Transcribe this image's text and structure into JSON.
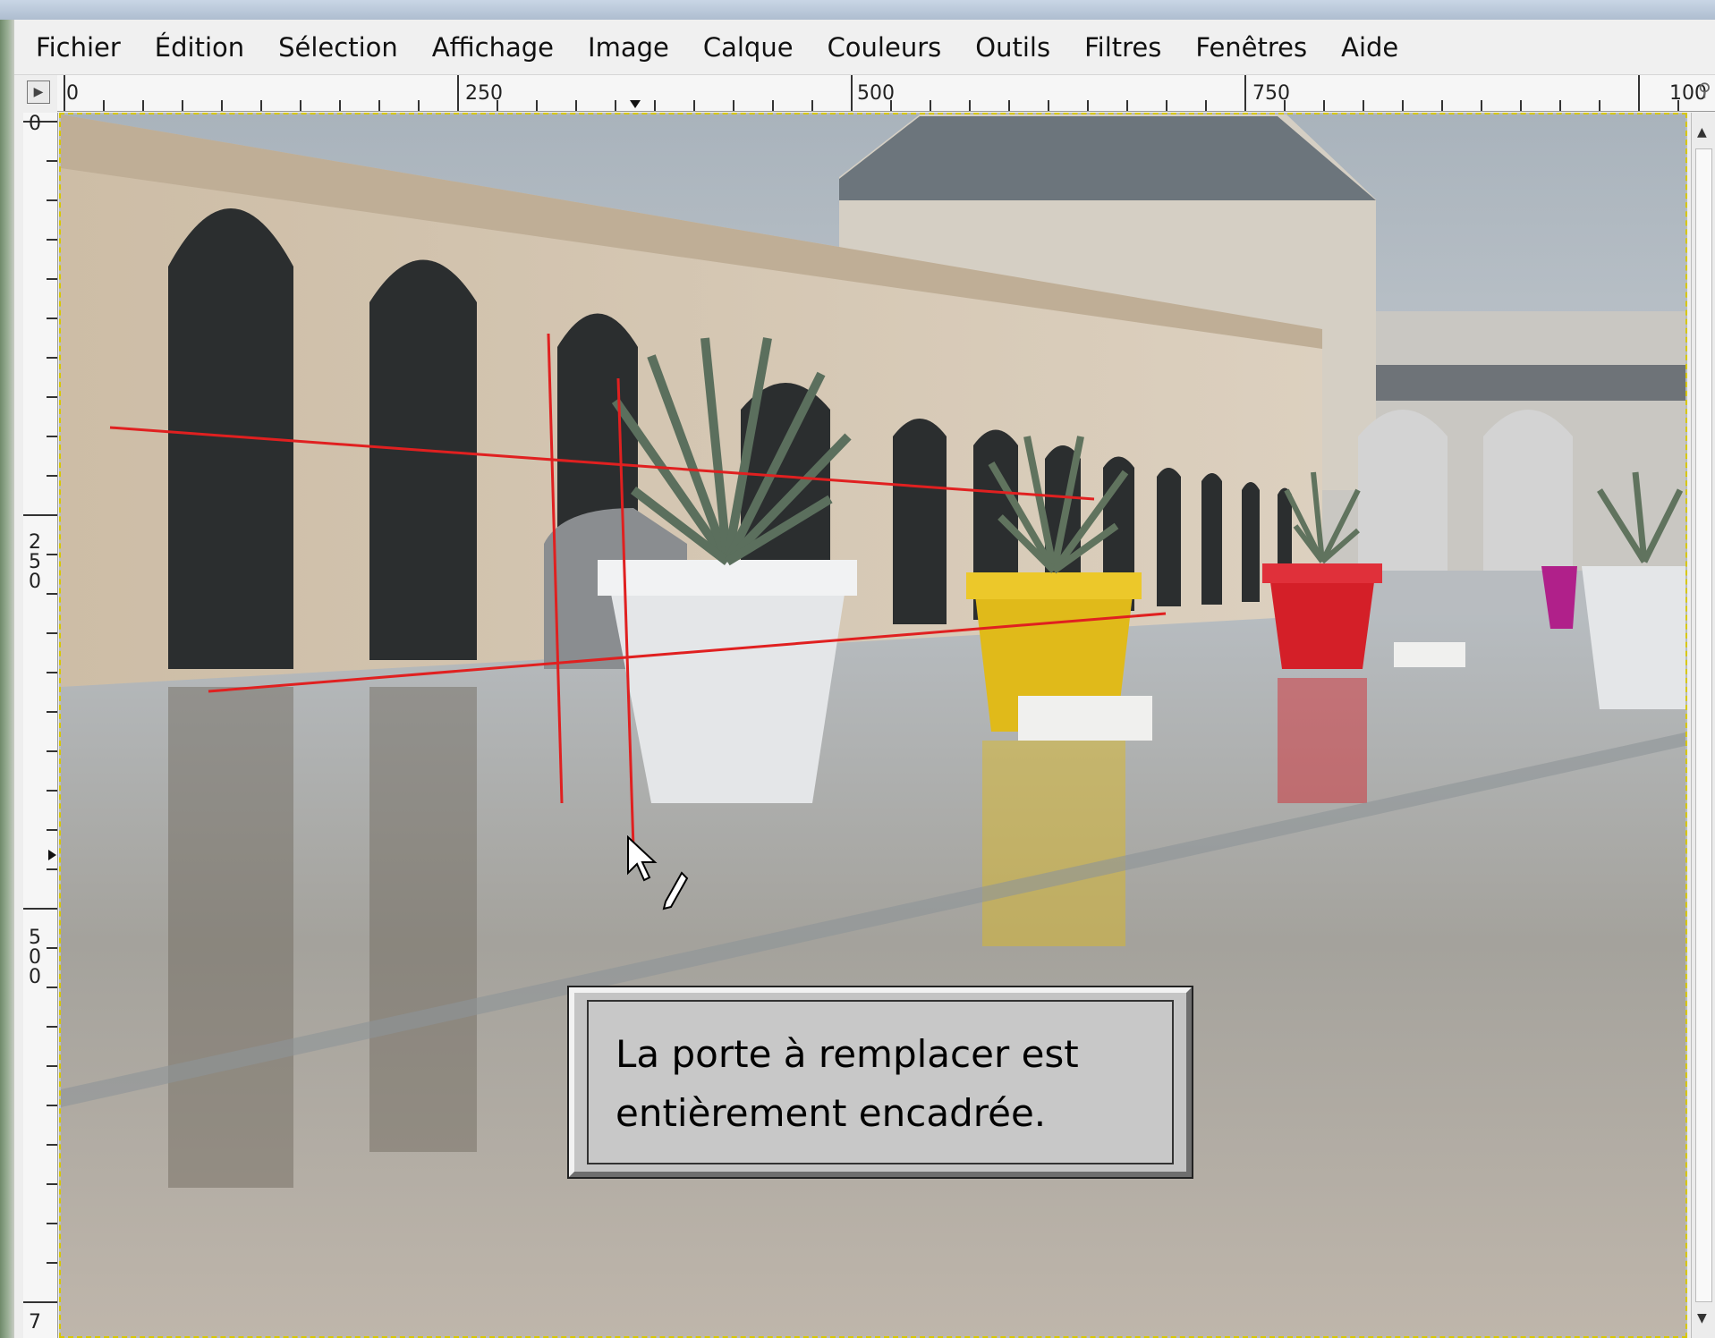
{
  "menubar": {
    "items": [
      {
        "label": "Fichier"
      },
      {
        "label": "Édition"
      },
      {
        "label": "Sélection"
      },
      {
        "label": "Affichage"
      },
      {
        "label": "Image"
      },
      {
        "label": "Calque"
      },
      {
        "label": "Couleurs"
      },
      {
        "label": "Outils"
      },
      {
        "label": "Filtres"
      },
      {
        "label": "Fenêtres"
      },
      {
        "label": "Aide"
      }
    ]
  },
  "rulers": {
    "horizontal_labels": [
      "0",
      "250",
      "500",
      "750",
      "100"
    ],
    "vertical_labels": [
      "0",
      "250",
      "500",
      "7"
    ]
  },
  "message": {
    "line1": "La porte à remplacer est",
    "line2": "entièrement encadrée."
  },
  "colors": {
    "guide_lines": "#e02020",
    "selection_marching_ants": "#d8c800",
    "pot_yellow": "#e8c018",
    "pot_red": "#d8202a",
    "pot_magenta": "#b0208a"
  },
  "icons": {
    "cursor": "arrow-cursor-icon",
    "tool": "paint-tool-icon"
  }
}
